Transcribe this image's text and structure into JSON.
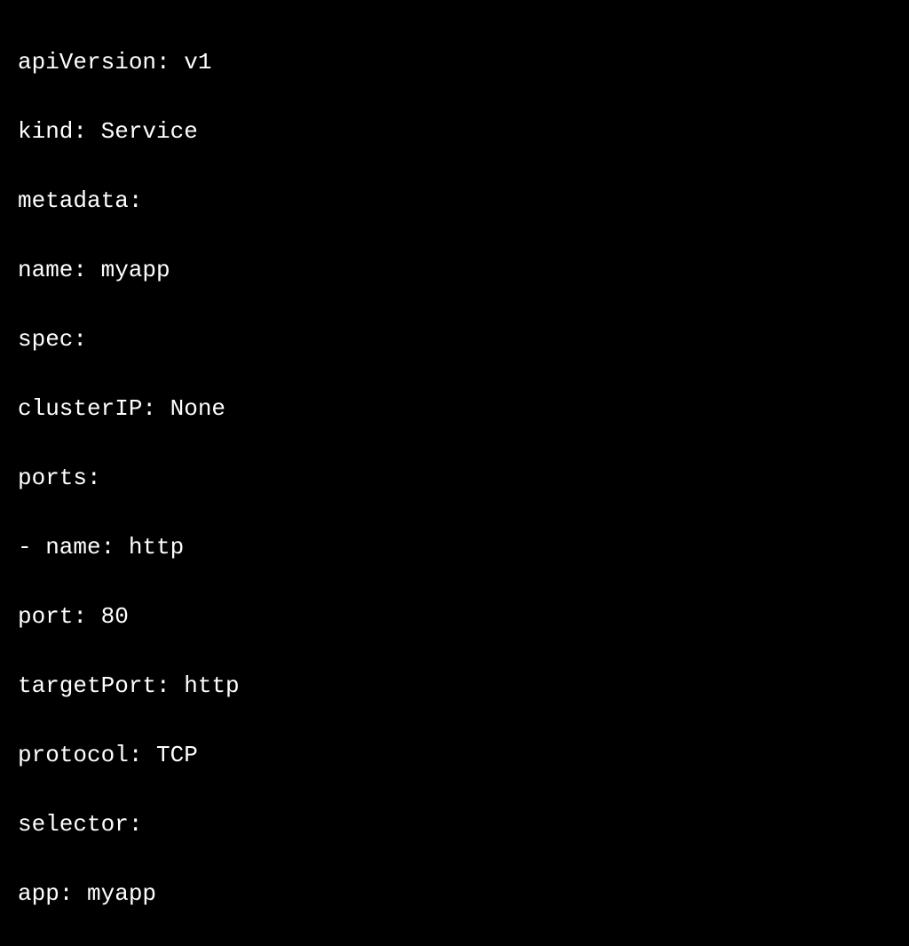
{
  "yaml": {
    "lines": [
      "apiVersion: v1",
      "kind: Service",
      "metadata:",
      "name: myapp",
      "spec:",
      "clusterIP: None",
      "ports:",
      "- name: http",
      "port: 80",
      "targetPort: http",
      "protocol: TCP",
      "selector:",
      "app: myapp"
    ]
  }
}
